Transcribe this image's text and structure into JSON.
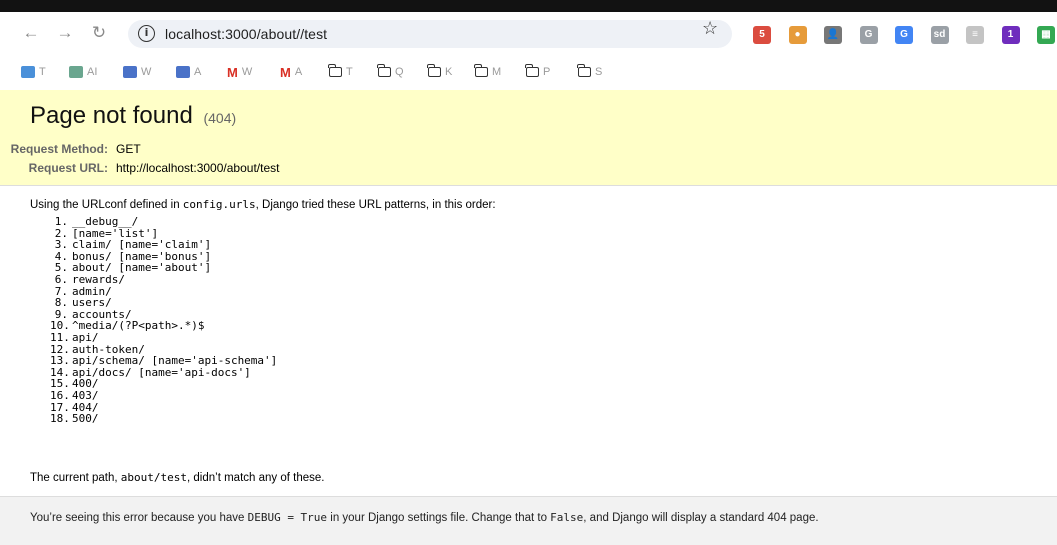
{
  "browser": {
    "url": "localhost:3000/about//test",
    "nav": {
      "back_icon": "←",
      "forward_icon": "→",
      "reload_icon": "↻",
      "star_icon": "☆"
    },
    "extensions": [
      {
        "name": "ext-todoist",
        "label": "5",
        "color": "#db4c3f"
      },
      {
        "name": "ext-owl",
        "label": "●",
        "color": "#e69b3a"
      },
      {
        "name": "ext-profile",
        "label": "👤",
        "color": "#777777"
      },
      {
        "name": "ext-grammarly",
        "label": "G",
        "color": "#9aa0a6"
      },
      {
        "name": "ext-translate",
        "label": "G",
        "color": "#4285f4"
      },
      {
        "name": "ext-sd",
        "label": "sd",
        "color": "#9aa0a6"
      },
      {
        "name": "ext-gray",
        "label": "≡",
        "color": "#c4c4c4"
      },
      {
        "name": "ext-purple",
        "label": "1",
        "color": "#6f2dbd"
      },
      {
        "name": "ext-multi",
        "label": "▦",
        "color": "#34a853"
      }
    ]
  },
  "bookmarks": [
    {
      "label": "T",
      "icon": "translate-bookmark-icon",
      "color": "#4a90d9"
    },
    {
      "label": "AI",
      "icon": "chatgpt-bookmark-icon",
      "color": "#6aa68f"
    },
    {
      "label": "W",
      "icon": "calendar-bookmark-icon",
      "color": "#4a72c8"
    },
    {
      "label": "A",
      "icon": "calendar-bookmark-icon",
      "color": "#4a72c8"
    },
    {
      "label": "W",
      "icon": "gmail-bookmark-icon",
      "color": "#d93025"
    },
    {
      "label": "A",
      "icon": "gmail-bookmark-icon",
      "color": "#d93025"
    },
    {
      "label": "T",
      "icon": "folder-icon",
      "color": "#333333"
    },
    {
      "label": "Q",
      "icon": "folder-icon",
      "color": "#333333"
    },
    {
      "label": "K",
      "icon": "folder-icon",
      "color": "#333333"
    },
    {
      "label": "M",
      "icon": "folder-icon",
      "color": "#333333"
    },
    {
      "label": "P",
      "icon": "folder-icon",
      "color": "#333333"
    },
    {
      "label": "S",
      "icon": "folder-icon",
      "color": "#333333"
    }
  ],
  "error": {
    "title": "Page not found",
    "code": "(404)",
    "method_label": "Request Method:",
    "method_value": "GET",
    "url_label": "Request URL:",
    "url_value": "http://localhost:3000/about/test"
  },
  "info": {
    "lead_pre": "Using the URLconf defined in ",
    "lead_code": "config.urls",
    "lead_post": ", Django tried these URL patterns, in this order:",
    "patterns": [
      "__debug__/",
      "[name='list']",
      "claim/ [name='claim']",
      "bonus/ [name='bonus']",
      "about/ [name='about']",
      "rewards/",
      "admin/",
      "users/",
      "accounts/",
      "^media/(?P<path>.*)$",
      "api/",
      "auth-token/",
      "api/schema/ [name='api-schema']",
      "api/docs/ [name='api-docs']",
      "400/",
      "403/",
      "404/",
      "500/"
    ],
    "current_pre": "The current path, ",
    "current_code": "about/test",
    "current_post": ", didn’t match any of these."
  },
  "explain": {
    "pre": "You’re seeing this error because you have ",
    "code1": "DEBUG = True",
    "mid": " in your Django settings file. Change that to ",
    "code2": "False",
    "post": ", and Django will display a standard 404 page."
  }
}
